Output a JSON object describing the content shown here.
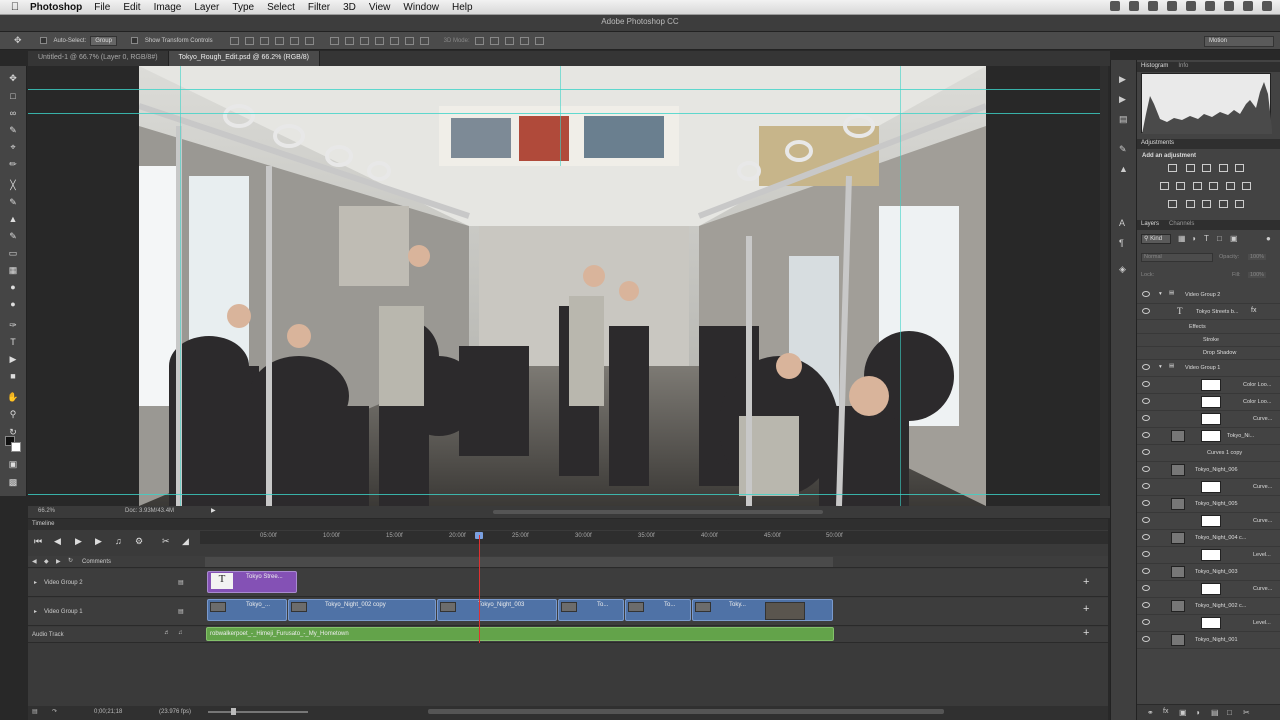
{
  "menubar": {
    "app": "Photoshop",
    "items": [
      "File",
      "Edit",
      "Image",
      "Layer",
      "Type",
      "Select",
      "Filter",
      "3D",
      "View",
      "Window",
      "Help"
    ]
  },
  "window": {
    "title": "Adobe Photoshop CC"
  },
  "options": {
    "auto_select": "Auto-Select:",
    "group": "Group",
    "show_transform": "Show Transform Controls",
    "mode_3d": "3D Mode:",
    "workspace": "Motion"
  },
  "tabs": [
    {
      "label": "Untitled-1 @ 66.7% (Layer 0, RGB/8#)"
    },
    {
      "label": "Tokyo_Rough_Edit.psd @ 66.2% (RGB/8)"
    }
  ],
  "status": {
    "zoom": "66.2%",
    "doc": "Doc: 3.93M/43.4M"
  },
  "timeline": {
    "title": "Timeline",
    "ticks": [
      "05:00f",
      "10:00f",
      "15:00f",
      "20:00f",
      "25:00f",
      "30:00f",
      "35:00f",
      "40:00f",
      "45:00f",
      "50:00f"
    ],
    "comments": "Comments",
    "tracks": [
      "Video Group 2",
      "Video Group 1",
      "Audio Track"
    ],
    "clips": {
      "text_clip": "Tokyo Stree...",
      "v1": "Tokyo_...",
      "v2": "Tokyo_Night_002 copy",
      "v3": "Tokyo_Night_003",
      "v4": "To...",
      "v5": "To...",
      "v6": "Toky...",
      "audio": "robwalkerpoet_-_Himeji_Furusato_-_My_Hometown"
    },
    "time": "0;00;21;18",
    "fps": "(23.976 fps)"
  },
  "panels": {
    "histogram": "Histogram",
    "info": "Info",
    "adjustments": "Adjustments",
    "add_adjustment": "Add an adjustment",
    "layers": "Layers",
    "channels": "Channels",
    "kind": "Kind",
    "blend": "Normal",
    "opacity": "Opacity:",
    "opacity_val": "100%",
    "lock": "Lock:",
    "fill": "Fill:",
    "fill_val": "100%"
  },
  "layers": [
    {
      "name": "Video Group 2"
    },
    {
      "name": "Tokyo Streets b..."
    },
    {
      "name": "Effects"
    },
    {
      "name": "Stroke"
    },
    {
      "name": "Drop Shadow"
    },
    {
      "name": "Video Group 1"
    },
    {
      "name": "Color Loo..."
    },
    {
      "name": "Color Loo..."
    },
    {
      "name": "Curve..."
    },
    {
      "name": "Tokyo_Ni..."
    },
    {
      "name": "Curves 1 copy"
    },
    {
      "name": "Tokyo_Night_006"
    },
    {
      "name": "Curve..."
    },
    {
      "name": "Tokyo_Night_005"
    },
    {
      "name": "Curve..."
    },
    {
      "name": "Tokyo_Night_004 c..."
    },
    {
      "name": "Level..."
    },
    {
      "name": "Tokyo_Night_003"
    },
    {
      "name": "Curve..."
    },
    {
      "name": "Tokyo_Night_002 c..."
    },
    {
      "name": "Level..."
    },
    {
      "name": "Tokyo_Night_001"
    }
  ]
}
